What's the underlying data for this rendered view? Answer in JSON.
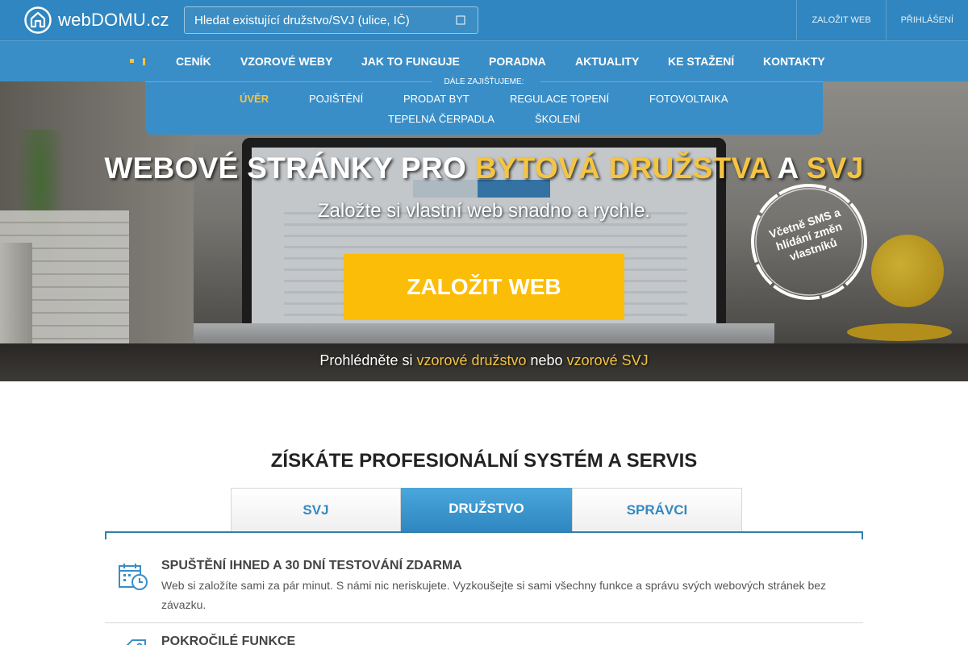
{
  "brand": {
    "logo_prefix": "web",
    "logo_main": "DOMU",
    "logo_suffix": ".cz"
  },
  "search": {
    "placeholder": "Hledat existující družstvo/SVJ (ulice, IČ)"
  },
  "top_links": [
    {
      "label": "ZALOŽIT WEB"
    },
    {
      "label": "PŘIHLÁŠENÍ"
    }
  ],
  "main_nav": {
    "items": [
      "CENÍK",
      "VZOROVÉ WEBY",
      "JAK TO FUNGUJE",
      "PORADNA",
      "AKTUALITY",
      "KE STAŽENÍ",
      "KONTAKTY"
    ]
  },
  "subpanel": {
    "title": "DÁLE ZAJIŠŤUJEME:",
    "items": [
      "ÚVĚR",
      "POJIŠTĚNÍ",
      "PRODAT BYT",
      "REGULACE TOPENÍ",
      "FOTOVOLTAIKA",
      "TEPELNÁ ČERPADLA",
      "ŠKOLENÍ"
    ],
    "active_index": 0
  },
  "hero": {
    "title_part1": "WEBOVÉ STRÁNKY PRO ",
    "title_highlight1": "BYTOVÁ DRUŽSTVA",
    "title_part2": " A ",
    "title_highlight2": "SVJ",
    "subtitle": "Založte si vlastní web snadno a rychle.",
    "cta_label": "ZALOŽIT WEB",
    "links_prefix": "Prohlédněte si ",
    "link1": "vzorové družstvo",
    "links_mid": " nebo ",
    "link2": "vzorové SVJ",
    "stamp_line1": "Včetně SMS a",
    "stamp_line2": "hlídání změn",
    "stamp_line3": "vlastníků"
  },
  "section": {
    "title": "ZÍSKÁTE PROFESIONÁLNÍ SYSTÉM A SERVIS",
    "tabs": [
      "SVJ",
      "DRUŽSTVO",
      "SPRÁVCI"
    ],
    "active_tab": 1,
    "features": [
      {
        "icon": "calendar-clock-icon",
        "title": "SPUŠTĚNÍ IHNED A 30 DNÍ TESTOVÁNÍ ZDARMA",
        "desc": "Web si založíte sami za pár minut. S námi nic neriskujete. Vyzkoušejte si sami všechny funkce a správu svých webových stránek bez závazku."
      },
      {
        "icon": "tag-icon",
        "title": "POKROČILÉ FUNKCE",
        "desc": ""
      }
    ]
  },
  "colors": {
    "primary": "#2f86c0",
    "accent": "#fbbd08",
    "highlight": "#f5c542"
  }
}
